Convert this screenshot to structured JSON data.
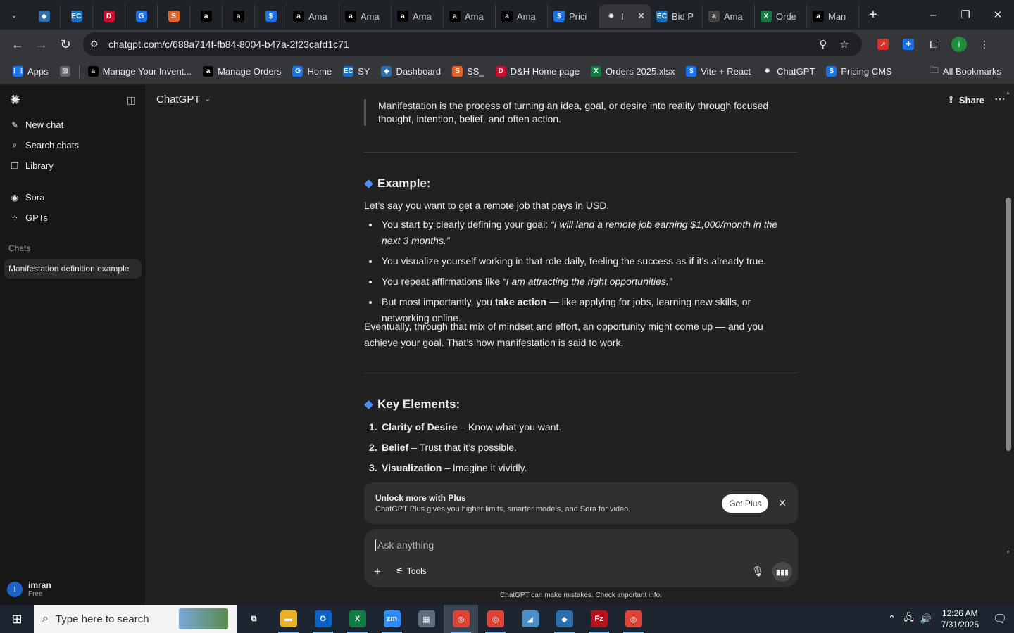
{
  "browser": {
    "tabs": [
      {
        "kind": "dropdown",
        "icon": "chevron-down-icon"
      },
      {
        "kind": "pinned",
        "letter": "◆",
        "color": "#2a6fb0",
        "icon": "diamond-icon"
      },
      {
        "kind": "pinned",
        "letter": "EC",
        "color": "#1a6fc0",
        "icon": "ec-icon"
      },
      {
        "kind": "pinned",
        "letter": "D",
        "color": "#c8102e",
        "icon": "dh-icon"
      },
      {
        "kind": "pinned",
        "letter": "G",
        "color": "#1a73e8",
        "icon": "g-icon"
      },
      {
        "kind": "pinned",
        "letter": "S",
        "color": "#e6622a",
        "icon": "stack-icon"
      },
      {
        "kind": "pinned",
        "letter": "a",
        "color": "#000000",
        "icon": "amazon-icon"
      },
      {
        "kind": "pinned",
        "letter": "a",
        "color": "#000000",
        "icon": "amazon-icon"
      },
      {
        "kind": "pinned",
        "letter": "$",
        "color": "#1a73e8",
        "icon": "dollar-icon"
      },
      {
        "kind": "titled",
        "letter": "a",
        "color": "#000000",
        "title": "Ama",
        "icon": "amazon-icon"
      },
      {
        "kind": "titled",
        "letter": "a",
        "color": "#000000",
        "title": "Ama",
        "icon": "amazon-icon"
      },
      {
        "kind": "titled",
        "letter": "a",
        "color": "#000000",
        "title": "Ama",
        "icon": "amazon-icon"
      },
      {
        "kind": "titled",
        "letter": "a",
        "color": "#000000",
        "title": "Ama",
        "icon": "amazon-icon"
      },
      {
        "kind": "titled",
        "letter": "a",
        "color": "#000000",
        "title": "Ama",
        "icon": "amazon-icon"
      },
      {
        "kind": "titled",
        "letter": "$",
        "color": "#1a73e8",
        "title": "Prici",
        "icon": "dollar-icon"
      },
      {
        "kind": "active",
        "letter": "✺",
        "color": "#35363a",
        "title": "I",
        "icon": "chatgpt-icon"
      },
      {
        "kind": "titled",
        "letter": "EC",
        "color": "#1a6fc0",
        "title": "Bid P",
        "icon": "ec-icon"
      },
      {
        "kind": "titled",
        "letter": "a",
        "color": "#444444",
        "title": "Ama",
        "icon": "amazon-icon"
      },
      {
        "kind": "titled",
        "letter": "X",
        "color": "#107c41",
        "title": "Orde",
        "icon": "excel-icon"
      },
      {
        "kind": "titled",
        "letter": "a",
        "color": "#000000",
        "title": "Man",
        "icon": "amazon-icon"
      }
    ],
    "url": "chatgpt.com/c/688a714f-fb84-8004-b47a-2f23cafd1c71",
    "bookmarks": [
      {
        "label": "Apps",
        "letter": "⋮⋮",
        "color": "#1a73e8",
        "icon": "apps-grid-icon"
      },
      {
        "label": "",
        "letter": "⊞",
        "color": "#5f6368",
        "icon": "tab-groups-icon"
      },
      {
        "sep": true
      },
      {
        "label": "Manage Your Invent...",
        "letter": "a",
        "color": "#000000",
        "icon": "amazon-icon"
      },
      {
        "label": "Manage Orders",
        "letter": "a",
        "color": "#000000",
        "icon": "amazon-icon"
      },
      {
        "label": "Home",
        "letter": "G",
        "color": "#1a73e8",
        "icon": "g-icon"
      },
      {
        "label": "SY",
        "letter": "EC",
        "color": "#1a6fc0",
        "icon": "ec-icon"
      },
      {
        "label": "Dashboard",
        "letter": "◆",
        "color": "#2a6fb0",
        "icon": "diamond-icon"
      },
      {
        "label": "SS_",
        "letter": "S",
        "color": "#e6622a",
        "icon": "stack-icon"
      },
      {
        "label": "D&H Home page",
        "letter": "D",
        "color": "#c8102e",
        "icon": "dh-icon"
      },
      {
        "label": "Orders 2025.xlsx",
        "letter": "X",
        "color": "#107c41",
        "icon": "excel-icon"
      },
      {
        "label": "Vite + React",
        "letter": "$",
        "color": "#1a73e8",
        "icon": "dollar-icon"
      },
      {
        "label": "ChatGPT",
        "letter": "✺",
        "color": "#35363a",
        "icon": "chatgpt-icon"
      },
      {
        "label": "Pricing CMS",
        "letter": "$",
        "color": "#1a73e8",
        "icon": "dollar-icon"
      }
    ],
    "all_bookmarks": "All Bookmarks"
  },
  "sidebar": {
    "items_top": [
      {
        "label": "New chat",
        "icon": "edit-icon",
        "glyph": "✎"
      },
      {
        "label": "Search chats",
        "icon": "search-icon",
        "glyph": "⌕"
      },
      {
        "label": "Library",
        "icon": "library-icon",
        "glyph": "❐"
      }
    ],
    "items_mid": [
      {
        "label": "Sora",
        "icon": "sora-icon",
        "glyph": "◉"
      },
      {
        "label": "GPTs",
        "icon": "gpts-icon",
        "glyph": "⁘"
      }
    ],
    "chats_title": "Chats",
    "chats": [
      "Manifestation definition example"
    ],
    "user": {
      "initial": "I",
      "name": "imran",
      "plan": "Free"
    }
  },
  "main": {
    "model": "ChatGPT",
    "share": "Share",
    "quote": "Manifestation is the process of turning an idea, goal, or desire into reality through focused thought, intention, belief, and often action.",
    "example_heading": "Example:",
    "example_intro": "Let’s say you want to get a remote job that pays in USD.",
    "bullets": [
      {
        "pre": "You start by clearly defining your goal: ",
        "em": "“I will land a remote job earning $1,000/month in the next 3 months.”",
        "bold": "",
        "post": ""
      },
      {
        "pre": "You visualize yourself working in that role daily, feeling the success as if it’s already true.",
        "em": "",
        "bold": "",
        "post": ""
      },
      {
        "pre": "You repeat affirmations like ",
        "em": "“I am attracting the right opportunities.”",
        "bold": "",
        "post": ""
      },
      {
        "pre": "But most importantly, you ",
        "em": "",
        "bold": "take action",
        "post": " — like applying for jobs, learning new skills, or networking online."
      }
    ],
    "conclusion": "Eventually, through that mix of mindset and effort, an opportunity might come up — and you achieve your goal. That’s how manifestation is said to work.",
    "key_heading": "Key Elements:",
    "key_elements": [
      {
        "num": "1.",
        "term": "Clarity of Desire",
        "desc": " – Know what you want."
      },
      {
        "num": "2.",
        "term": "Belief",
        "desc": " – Trust that it’s possible."
      },
      {
        "num": "3.",
        "term": "Visualization",
        "desc": " – Imagine it vividly."
      }
    ],
    "upsell": {
      "title": "Unlock more with Plus",
      "desc": "ChatGPT Plus gives you higher limits, smarter models, and Sora for video.",
      "button": "Get Plus"
    },
    "composer": {
      "placeholder": "Ask anything",
      "tools": "Tools"
    },
    "disclaimer": "ChatGPT can make mistakes. Check important info."
  },
  "taskbar": {
    "search_placeholder": "Type here to search",
    "apps": [
      {
        "icon": "task-view-icon",
        "glyph": "⧉",
        "color": "transparent",
        "state": ""
      },
      {
        "icon": "file-explorer-icon",
        "glyph": "▬",
        "color": "#e8b224",
        "state": "running"
      },
      {
        "icon": "outlook-icon",
        "glyph": "O",
        "color": "#0a64c8",
        "state": "running"
      },
      {
        "icon": "excel-icon",
        "glyph": "X",
        "color": "#107c41",
        "state": "running"
      },
      {
        "icon": "zoom-icon",
        "glyph": "zm",
        "color": "#2d8cff",
        "state": "running"
      },
      {
        "icon": "calculator-icon",
        "glyph": "▦",
        "color": "#5b6c7d",
        "state": ""
      },
      {
        "icon": "chrome-icon",
        "glyph": "◎",
        "color": "#db4437",
        "state": "active running"
      },
      {
        "icon": "chrome-icon",
        "glyph": "◎",
        "color": "#db4437",
        "state": "running"
      },
      {
        "icon": "app-icon",
        "glyph": "◢",
        "color": "#4a8fc9",
        "state": ""
      },
      {
        "icon": "app-diamond-icon",
        "glyph": "◆",
        "color": "#2a6fb0",
        "state": "running"
      },
      {
        "icon": "filezilla-icon",
        "glyph": "Fz",
        "color": "#b5121b",
        "state": "running"
      },
      {
        "icon": "chrome-icon",
        "glyph": "◎",
        "color": "#db4437",
        "state": "running"
      }
    ],
    "time": "12:26 AM",
    "date": "7/31/2025"
  }
}
